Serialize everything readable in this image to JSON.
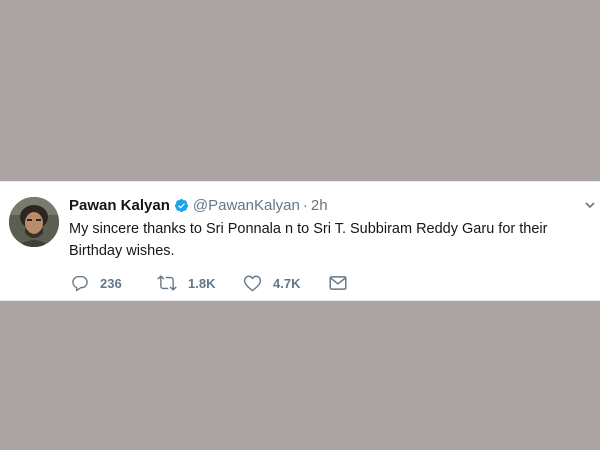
{
  "tweet": {
    "display_name": "Pawan Kalyan",
    "handle": "@PawanKalyan",
    "separator": "·",
    "time": "2h",
    "text": "My sincere thanks to Sri Ponnala n to Sri T. Subbiram Reddy Garu for their Birthday wishes.",
    "verified": true,
    "icons": {
      "verified": "verified-badge-icon",
      "reply": "reply-icon",
      "retweet": "retweet-icon",
      "like": "heart-icon",
      "message": "envelope-icon",
      "more": "chevron-down-icon"
    },
    "stats": {
      "replies": "236",
      "retweets": "1.8K",
      "likes": "4.7K"
    }
  },
  "colors": {
    "background": "#aaa4a3",
    "card": "#ffffff",
    "verified": "#1da1f2",
    "muted": "#657786",
    "text": "#14171a"
  }
}
